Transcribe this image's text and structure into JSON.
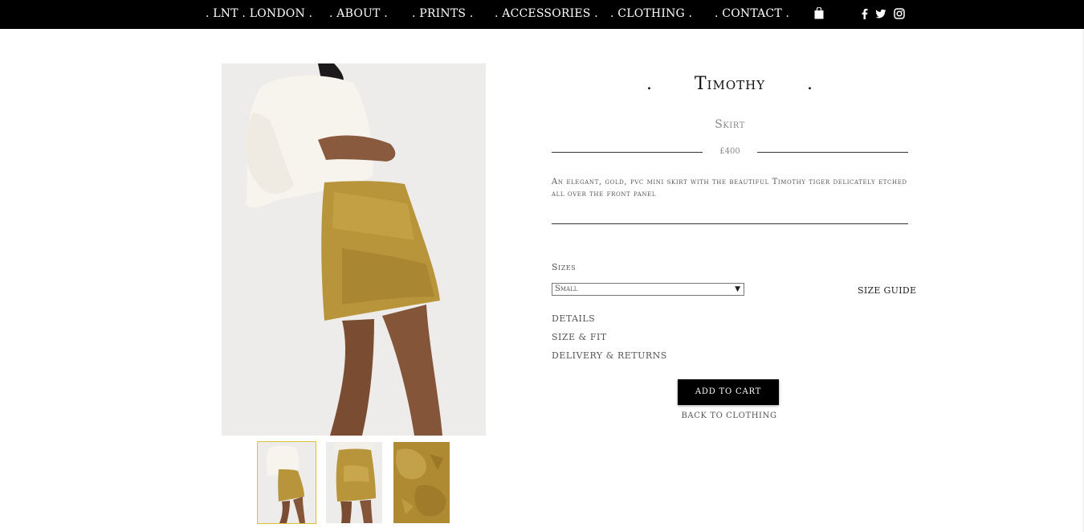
{
  "nav": {
    "items": [
      ". LNT . LONDON .",
      ". ABOUT .",
      ". PRINTS .",
      ". ACCESSORIES .",
      ". CLOTHING .",
      ". CONTACT ."
    ],
    "cart_icon": "shopping-bag-icon",
    "social": [
      "facebook-icon",
      "twitter-icon",
      "instagram-icon"
    ]
  },
  "product": {
    "title": "Timothy",
    "title_dot": ".",
    "subtitle": "Skirt",
    "price": "£400",
    "description": "An elegant, gold, pvc mini skirt with the beautiful Timothy tiger delicately etched all over the front panel",
    "sizes_label": "Sizes",
    "selected_size": "Small",
    "size_guide": "SIZE GUIDE",
    "info_links": [
      "DETAILS",
      "SIZE & FIT",
      "DELIVERY & RETURNS"
    ],
    "add_to_cart": "ADD TO CART",
    "back_link": "BACK TO CLOTHING"
  },
  "colors": {
    "nav_bg": "#000000",
    "accent_gold": "#b8953a",
    "thumb_active_border": "#d9c338"
  }
}
